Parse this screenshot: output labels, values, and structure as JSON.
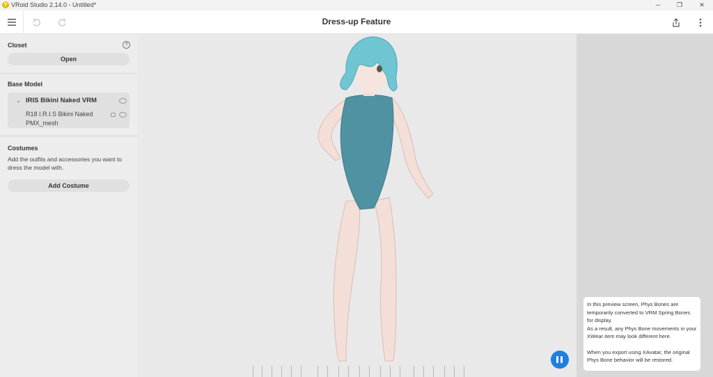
{
  "window": {
    "title": "VRoid Studio 2.14.0 - Untitled*",
    "logo_letter": "V"
  },
  "toolbar": {
    "page_title": "Dress-up Feature",
    "menu_icon": "hamburger-menu-icon",
    "undo_icon": "undo-icon",
    "redo_icon": "redo-icon",
    "share_icon": "share-icon",
    "more_icon": "more-vertical-icon"
  },
  "sidebar": {
    "closet": {
      "title": "Closet",
      "open_label": "Open",
      "help": "?"
    },
    "base_model": {
      "title": "Base Model",
      "model_name": "IRIS Bikini Naked VRM",
      "mesh_name": "R18 I.R.I.S Bikini Naked PMX_mesh"
    },
    "costumes": {
      "title": "Costumes",
      "description": "Add the outfits and accessories you want to dress the model with.",
      "add_label": "Add Costume"
    }
  },
  "info_panel": {
    "p1": "In this preview screen, Phys Bones are temporarily converted to VRM Spring Bones for display.",
    "p2": "As a result, any Phys Bone movements in your XWear item may look different here.",
    "p3": "When you export using XAvatar, the original Phys Bone behavior will be restored."
  },
  "colors": {
    "accent": "#1f7fe0",
    "hair": "#6fc6d2",
    "swimsuit": "#4f93a3",
    "skin": "#f4ded8"
  }
}
